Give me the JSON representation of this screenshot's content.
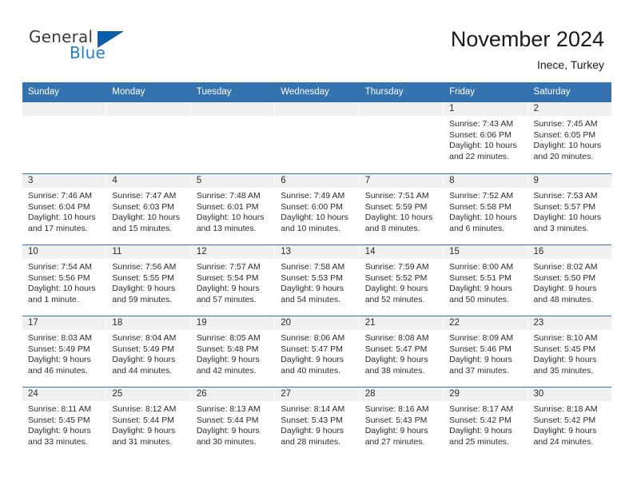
{
  "branding": {
    "logo_primary": "General",
    "logo_secondary": "Blue",
    "logo_triangle_color": "#0a5ca8",
    "logo_blue_color": "#2580c3"
  },
  "header": {
    "title": "November 2024",
    "location": "Inece, Turkey"
  },
  "theme": {
    "header_blue": "#3572b0",
    "date_band_gray": "#f0f0f0",
    "text_color": "#2b2b2b"
  },
  "weekdays": [
    "Sunday",
    "Monday",
    "Tuesday",
    "Wednesday",
    "Thursday",
    "Friday",
    "Saturday"
  ],
  "labels": {
    "sunrise_prefix": "Sunrise:",
    "sunset_prefix": "Sunset:",
    "daylight_prefix": "Daylight:"
  },
  "weeks": [
    [
      {
        "day": "",
        "empty": true
      },
      {
        "day": "",
        "empty": true
      },
      {
        "day": "",
        "empty": true
      },
      {
        "day": "",
        "empty": true
      },
      {
        "day": "",
        "empty": true
      },
      {
        "day": "1",
        "sunrise": "Sunrise: 7:43 AM",
        "sunset": "Sunset: 6:06 PM",
        "daylight_l1": "Daylight: 10 hours",
        "daylight_l2": "and 22 minutes."
      },
      {
        "day": "2",
        "sunrise": "Sunrise: 7:45 AM",
        "sunset": "Sunset: 6:05 PM",
        "daylight_l1": "Daylight: 10 hours",
        "daylight_l2": "and 20 minutes."
      }
    ],
    [
      {
        "day": "3",
        "sunrise": "Sunrise: 7:46 AM",
        "sunset": "Sunset: 6:04 PM",
        "daylight_l1": "Daylight: 10 hours",
        "daylight_l2": "and 17 minutes."
      },
      {
        "day": "4",
        "sunrise": "Sunrise: 7:47 AM",
        "sunset": "Sunset: 6:03 PM",
        "daylight_l1": "Daylight: 10 hours",
        "daylight_l2": "and 15 minutes."
      },
      {
        "day": "5",
        "sunrise": "Sunrise: 7:48 AM",
        "sunset": "Sunset: 6:01 PM",
        "daylight_l1": "Daylight: 10 hours",
        "daylight_l2": "and 13 minutes."
      },
      {
        "day": "6",
        "sunrise": "Sunrise: 7:49 AM",
        "sunset": "Sunset: 6:00 PM",
        "daylight_l1": "Daylight: 10 hours",
        "daylight_l2": "and 10 minutes."
      },
      {
        "day": "7",
        "sunrise": "Sunrise: 7:51 AM",
        "sunset": "Sunset: 5:59 PM",
        "daylight_l1": "Daylight: 10 hours",
        "daylight_l2": "and 8 minutes."
      },
      {
        "day": "8",
        "sunrise": "Sunrise: 7:52 AM",
        "sunset": "Sunset: 5:58 PM",
        "daylight_l1": "Daylight: 10 hours",
        "daylight_l2": "and 6 minutes."
      },
      {
        "day": "9",
        "sunrise": "Sunrise: 7:53 AM",
        "sunset": "Sunset: 5:57 PM",
        "daylight_l1": "Daylight: 10 hours",
        "daylight_l2": "and 3 minutes."
      }
    ],
    [
      {
        "day": "10",
        "sunrise": "Sunrise: 7:54 AM",
        "sunset": "Sunset: 5:56 PM",
        "daylight_l1": "Daylight: 10 hours",
        "daylight_l2": "and 1 minute."
      },
      {
        "day": "11",
        "sunrise": "Sunrise: 7:56 AM",
        "sunset": "Sunset: 5:55 PM",
        "daylight_l1": "Daylight: 9 hours",
        "daylight_l2": "and 59 minutes."
      },
      {
        "day": "12",
        "sunrise": "Sunrise: 7:57 AM",
        "sunset": "Sunset: 5:54 PM",
        "daylight_l1": "Daylight: 9 hours",
        "daylight_l2": "and 57 minutes."
      },
      {
        "day": "13",
        "sunrise": "Sunrise: 7:58 AM",
        "sunset": "Sunset: 5:53 PM",
        "daylight_l1": "Daylight: 9 hours",
        "daylight_l2": "and 54 minutes."
      },
      {
        "day": "14",
        "sunrise": "Sunrise: 7:59 AM",
        "sunset": "Sunset: 5:52 PM",
        "daylight_l1": "Daylight: 9 hours",
        "daylight_l2": "and 52 minutes."
      },
      {
        "day": "15",
        "sunrise": "Sunrise: 8:00 AM",
        "sunset": "Sunset: 5:51 PM",
        "daylight_l1": "Daylight: 9 hours",
        "daylight_l2": "and 50 minutes."
      },
      {
        "day": "16",
        "sunrise": "Sunrise: 8:02 AM",
        "sunset": "Sunset: 5:50 PM",
        "daylight_l1": "Daylight: 9 hours",
        "daylight_l2": "and 48 minutes."
      }
    ],
    [
      {
        "day": "17",
        "sunrise": "Sunrise: 8:03 AM",
        "sunset": "Sunset: 5:49 PM",
        "daylight_l1": "Daylight: 9 hours",
        "daylight_l2": "and 46 minutes."
      },
      {
        "day": "18",
        "sunrise": "Sunrise: 8:04 AM",
        "sunset": "Sunset: 5:49 PM",
        "daylight_l1": "Daylight: 9 hours",
        "daylight_l2": "and 44 minutes."
      },
      {
        "day": "19",
        "sunrise": "Sunrise: 8:05 AM",
        "sunset": "Sunset: 5:48 PM",
        "daylight_l1": "Daylight: 9 hours",
        "daylight_l2": "and 42 minutes."
      },
      {
        "day": "20",
        "sunrise": "Sunrise: 8:06 AM",
        "sunset": "Sunset: 5:47 PM",
        "daylight_l1": "Daylight: 9 hours",
        "daylight_l2": "and 40 minutes."
      },
      {
        "day": "21",
        "sunrise": "Sunrise: 8:08 AM",
        "sunset": "Sunset: 5:47 PM",
        "daylight_l1": "Daylight: 9 hours",
        "daylight_l2": "and 38 minutes."
      },
      {
        "day": "22",
        "sunrise": "Sunrise: 8:09 AM",
        "sunset": "Sunset: 5:46 PM",
        "daylight_l1": "Daylight: 9 hours",
        "daylight_l2": "and 37 minutes."
      },
      {
        "day": "23",
        "sunrise": "Sunrise: 8:10 AM",
        "sunset": "Sunset: 5:45 PM",
        "daylight_l1": "Daylight: 9 hours",
        "daylight_l2": "and 35 minutes."
      }
    ],
    [
      {
        "day": "24",
        "sunrise": "Sunrise: 8:11 AM",
        "sunset": "Sunset: 5:45 PM",
        "daylight_l1": "Daylight: 9 hours",
        "daylight_l2": "and 33 minutes."
      },
      {
        "day": "25",
        "sunrise": "Sunrise: 8:12 AM",
        "sunset": "Sunset: 5:44 PM",
        "daylight_l1": "Daylight: 9 hours",
        "daylight_l2": "and 31 minutes."
      },
      {
        "day": "26",
        "sunrise": "Sunrise: 8:13 AM",
        "sunset": "Sunset: 5:44 PM",
        "daylight_l1": "Daylight: 9 hours",
        "daylight_l2": "and 30 minutes."
      },
      {
        "day": "27",
        "sunrise": "Sunrise: 8:14 AM",
        "sunset": "Sunset: 5:43 PM",
        "daylight_l1": "Daylight: 9 hours",
        "daylight_l2": "and 28 minutes."
      },
      {
        "day": "28",
        "sunrise": "Sunrise: 8:16 AM",
        "sunset": "Sunset: 5:43 PM",
        "daylight_l1": "Daylight: 9 hours",
        "daylight_l2": "and 27 minutes."
      },
      {
        "day": "29",
        "sunrise": "Sunrise: 8:17 AM",
        "sunset": "Sunset: 5:42 PM",
        "daylight_l1": "Daylight: 9 hours",
        "daylight_l2": "and 25 minutes."
      },
      {
        "day": "30",
        "sunrise": "Sunrise: 8:18 AM",
        "sunset": "Sunset: 5:42 PM",
        "daylight_l1": "Daylight: 9 hours",
        "daylight_l2": "and 24 minutes."
      }
    ]
  ]
}
